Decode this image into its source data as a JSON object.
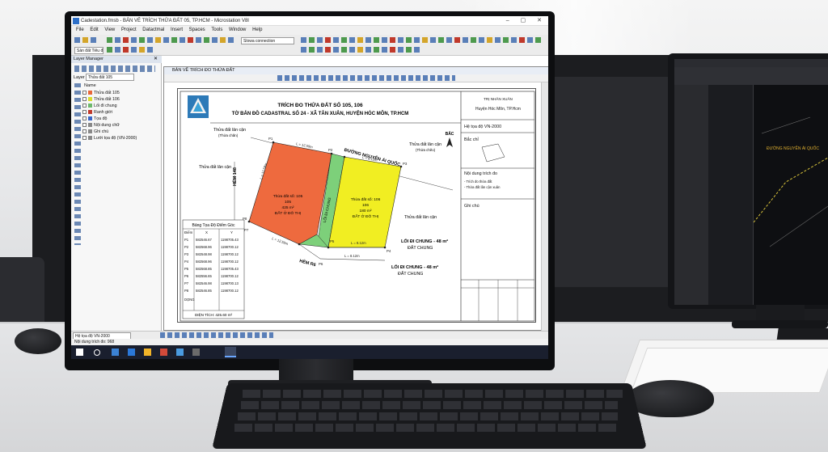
{
  "app": {
    "title": "Cadestation.fmsb - BẢN VẼ TRÍCH THỬA ĐẤT 05, TP.HCM - Microstation V8I",
    "menu": [
      "File",
      "Edit",
      "View",
      "Project",
      "Datactmal",
      "Insert",
      "Spaces",
      "Tools",
      "Window",
      "Help"
    ],
    "toolbar": {
      "level_combo": "Sàn đất Tiêu đức",
      "conn_combo": "Slowa connection"
    },
    "layer_manager": {
      "title": "Layer Manager",
      "layer_label": "Layer",
      "layer_value": "Thửa đất 105",
      "col_header": "Name",
      "items": [
        "Thửa đất 105",
        "Thửa đất 106",
        "Lối đi chung",
        "Ranh giới",
        "Tọa độ",
        "Nội dung chữ",
        "Ghi chú",
        "Lưới tọa độ (VN-2000)"
      ],
      "item_colors": [
        "#e8673a",
        "#d9dc2e",
        "#6cb86c",
        "#c0392b",
        "#3a66c7",
        "#888888",
        "#888888",
        "#888888"
      ]
    },
    "view": {
      "title": "BẢN VẼ TRÍCH ĐO THỬA ĐẤT"
    },
    "statusbar": {
      "coord_combo": "Hệ tọa độ VN-2000",
      "text": "Nội dung trích đo: 968"
    }
  },
  "drawing": {
    "title1": "TRÍCH ĐO THỬA ĐẤT SỐ 105, 106",
    "title2": "TỜ BẢN ĐỒ CADASTRAL SỐ 24 - XÃ TÂN XUÂN, HUYỆN HÓC MÔN, TP.HCM",
    "street": "ĐƯỜNG NGUYỄN ÁI QUỐC",
    "alley": "HẺM 148",
    "alley2": "HẺM R6",
    "neighbor1": "Thửa đất lân cận",
    "neighbor1_sub": "(Thửa chăn)",
    "neighbor2": "Thửa đất lân cận",
    "neighbor2_sub": "(Thửa chẽo)",
    "neighbor3": "Thửa đất lân cận",
    "neighbor4": "Thửa đất lân cận",
    "north": "BẮC",
    "parcel105": {
      "line1": "Thửa đất số: 105",
      "line2": "105",
      "line3": "425 m²",
      "line4": "ĐẤT Ở ĐÔ THỊ",
      "color": "#ee6a3e"
    },
    "parcel106": {
      "line1": "Thửa đất số: 106",
      "line2": "106",
      "line3": "180 m²",
      "line4": "ĐẤT Ở ĐÔ THỊ",
      "color": "#f1ee22"
    },
    "path_label": "LỐI ĐI CHUNG",
    "path1": "LỐI ĐI CHUNG - 48 m²",
    "path1_sub": "ĐẤT CHUNG",
    "path2": "LỐI ĐI CHUNG - 48 m²",
    "path2_sub": "ĐẤT CHUNG",
    "dims": [
      "L = 12.59m",
      "L = 8.12m",
      "L = 12.59m",
      "L = 8.12m",
      "L = 8.12m",
      "L = 12.59m"
    ],
    "points": [
      "P1",
      "P2",
      "P3",
      "P4",
      "P5",
      "P6",
      "P7",
      "P8"
    ],
    "table": {
      "title": "Bảng Tọa Độ Điểm Góc",
      "headers": [
        "Điểm",
        "X",
        "Y"
      ],
      "rows": [
        [
          "P1",
          "582546.67",
          "1198705.43"
        ],
        [
          "P2",
          "582568.96",
          "1198700.12"
        ],
        [
          "P3",
          "582548.98",
          "1198700.12"
        ],
        [
          "P4",
          "582568.96",
          "1198700.12"
        ],
        [
          "P5",
          "582568.85",
          "1198705.43"
        ],
        [
          "P6",
          "582556.65",
          "1198700.12"
        ],
        [
          "P7",
          "582546.98",
          "1198700.13"
        ],
        [
          "P8",
          "582546.85",
          "1198700.12"
        ],
        [
          "DỌNG",
          "",
          ""
        ]
      ],
      "area": "DIỆN TÍCH: 425.60 m²"
    },
    "side": {
      "org": "TRỊ NHÂN XUÂN",
      "org2": "Huyện Hóc Môn, TP.Hcm",
      "coord": "Hệ tọa độ VN-2000",
      "north": "Bắc chỉ",
      "content": "Nội dung trích đo",
      "content_items": [
        "- Trích đo thửa đất",
        "- Thửa đất lân cận xuân"
      ],
      "note": "Ghi chú"
    }
  },
  "right_monitor": {
    "label": "ĐƯỜNG NGUYỄN ÁI QUỐC"
  }
}
